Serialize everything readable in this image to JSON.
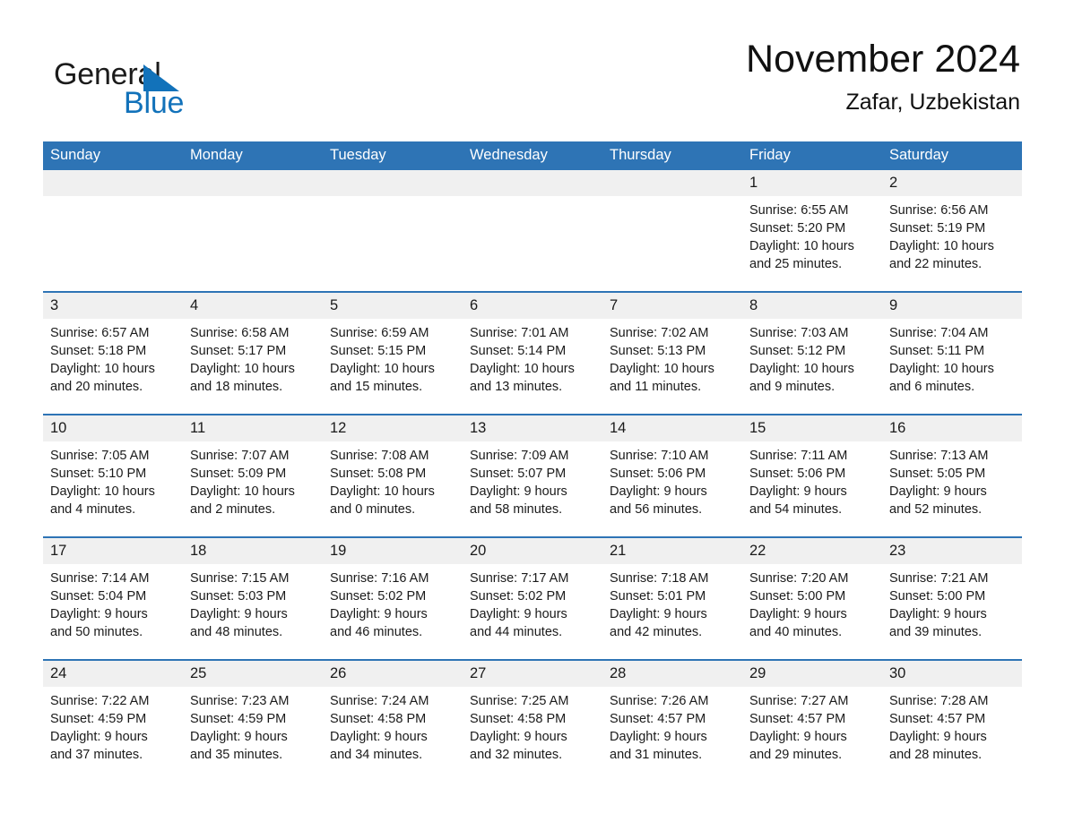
{
  "brand": {
    "name_part1": "General",
    "name_part2": "Blue",
    "logo_icon": "triangle-flag-icon",
    "accent_color": "#1272ba"
  },
  "header": {
    "title": "November 2024",
    "location": "Zafar, Uzbekistan"
  },
  "theme": {
    "header_blue": "#2e74b5",
    "daynum_band": "#f0f0f0",
    "text": "#1a1a1a"
  },
  "calendar": {
    "weekday_headers": [
      "Sunday",
      "Monday",
      "Tuesday",
      "Wednesday",
      "Thursday",
      "Friday",
      "Saturday"
    ],
    "labels": {
      "sunrise": "Sunrise:",
      "sunset": "Sunset:",
      "daylight": "Daylight:"
    },
    "weeks": [
      [
        {
          "day": "",
          "empty": true,
          "sunrise": "",
          "sunset": "",
          "daylight_line1": "",
          "daylight_line2": ""
        },
        {
          "day": "",
          "empty": true,
          "sunrise": "",
          "sunset": "",
          "daylight_line1": "",
          "daylight_line2": ""
        },
        {
          "day": "",
          "empty": true,
          "sunrise": "",
          "sunset": "",
          "daylight_line1": "",
          "daylight_line2": ""
        },
        {
          "day": "",
          "empty": true,
          "sunrise": "",
          "sunset": "",
          "daylight_line1": "",
          "daylight_line2": ""
        },
        {
          "day": "",
          "empty": true,
          "sunrise": "",
          "sunset": "",
          "daylight_line1": "",
          "daylight_line2": ""
        },
        {
          "day": "1",
          "empty": false,
          "sunrise": "Sunrise: 6:55 AM",
          "sunset": "Sunset: 5:20 PM",
          "daylight_line1": "Daylight: 10 hours",
          "daylight_line2": "and 25 minutes."
        },
        {
          "day": "2",
          "empty": false,
          "sunrise": "Sunrise: 6:56 AM",
          "sunset": "Sunset: 5:19 PM",
          "daylight_line1": "Daylight: 10 hours",
          "daylight_line2": "and 22 minutes."
        }
      ],
      [
        {
          "day": "3",
          "empty": false,
          "sunrise": "Sunrise: 6:57 AM",
          "sunset": "Sunset: 5:18 PM",
          "daylight_line1": "Daylight: 10 hours",
          "daylight_line2": "and 20 minutes."
        },
        {
          "day": "4",
          "empty": false,
          "sunrise": "Sunrise: 6:58 AM",
          "sunset": "Sunset: 5:17 PM",
          "daylight_line1": "Daylight: 10 hours",
          "daylight_line2": "and 18 minutes."
        },
        {
          "day": "5",
          "empty": false,
          "sunrise": "Sunrise: 6:59 AM",
          "sunset": "Sunset: 5:15 PM",
          "daylight_line1": "Daylight: 10 hours",
          "daylight_line2": "and 15 minutes."
        },
        {
          "day": "6",
          "empty": false,
          "sunrise": "Sunrise: 7:01 AM",
          "sunset": "Sunset: 5:14 PM",
          "daylight_line1": "Daylight: 10 hours",
          "daylight_line2": "and 13 minutes."
        },
        {
          "day": "7",
          "empty": false,
          "sunrise": "Sunrise: 7:02 AM",
          "sunset": "Sunset: 5:13 PM",
          "daylight_line1": "Daylight: 10 hours",
          "daylight_line2": "and 11 minutes."
        },
        {
          "day": "8",
          "empty": false,
          "sunrise": "Sunrise: 7:03 AM",
          "sunset": "Sunset: 5:12 PM",
          "daylight_line1": "Daylight: 10 hours",
          "daylight_line2": "and 9 minutes."
        },
        {
          "day": "9",
          "empty": false,
          "sunrise": "Sunrise: 7:04 AM",
          "sunset": "Sunset: 5:11 PM",
          "daylight_line1": "Daylight: 10 hours",
          "daylight_line2": "and 6 minutes."
        }
      ],
      [
        {
          "day": "10",
          "empty": false,
          "sunrise": "Sunrise: 7:05 AM",
          "sunset": "Sunset: 5:10 PM",
          "daylight_line1": "Daylight: 10 hours",
          "daylight_line2": "and 4 minutes."
        },
        {
          "day": "11",
          "empty": false,
          "sunrise": "Sunrise: 7:07 AM",
          "sunset": "Sunset: 5:09 PM",
          "daylight_line1": "Daylight: 10 hours",
          "daylight_line2": "and 2 minutes."
        },
        {
          "day": "12",
          "empty": false,
          "sunrise": "Sunrise: 7:08 AM",
          "sunset": "Sunset: 5:08 PM",
          "daylight_line1": "Daylight: 10 hours",
          "daylight_line2": "and 0 minutes."
        },
        {
          "day": "13",
          "empty": false,
          "sunrise": "Sunrise: 7:09 AM",
          "sunset": "Sunset: 5:07 PM",
          "daylight_line1": "Daylight: 9 hours",
          "daylight_line2": "and 58 minutes."
        },
        {
          "day": "14",
          "empty": false,
          "sunrise": "Sunrise: 7:10 AM",
          "sunset": "Sunset: 5:06 PM",
          "daylight_line1": "Daylight: 9 hours",
          "daylight_line2": "and 56 minutes."
        },
        {
          "day": "15",
          "empty": false,
          "sunrise": "Sunrise: 7:11 AM",
          "sunset": "Sunset: 5:06 PM",
          "daylight_line1": "Daylight: 9 hours",
          "daylight_line2": "and 54 minutes."
        },
        {
          "day": "16",
          "empty": false,
          "sunrise": "Sunrise: 7:13 AM",
          "sunset": "Sunset: 5:05 PM",
          "daylight_line1": "Daylight: 9 hours",
          "daylight_line2": "and 52 minutes."
        }
      ],
      [
        {
          "day": "17",
          "empty": false,
          "sunrise": "Sunrise: 7:14 AM",
          "sunset": "Sunset: 5:04 PM",
          "daylight_line1": "Daylight: 9 hours",
          "daylight_line2": "and 50 minutes."
        },
        {
          "day": "18",
          "empty": false,
          "sunrise": "Sunrise: 7:15 AM",
          "sunset": "Sunset: 5:03 PM",
          "daylight_line1": "Daylight: 9 hours",
          "daylight_line2": "and 48 minutes."
        },
        {
          "day": "19",
          "empty": false,
          "sunrise": "Sunrise: 7:16 AM",
          "sunset": "Sunset: 5:02 PM",
          "daylight_line1": "Daylight: 9 hours",
          "daylight_line2": "and 46 minutes."
        },
        {
          "day": "20",
          "empty": false,
          "sunrise": "Sunrise: 7:17 AM",
          "sunset": "Sunset: 5:02 PM",
          "daylight_line1": "Daylight: 9 hours",
          "daylight_line2": "and 44 minutes."
        },
        {
          "day": "21",
          "empty": false,
          "sunrise": "Sunrise: 7:18 AM",
          "sunset": "Sunset: 5:01 PM",
          "daylight_line1": "Daylight: 9 hours",
          "daylight_line2": "and 42 minutes."
        },
        {
          "day": "22",
          "empty": false,
          "sunrise": "Sunrise: 7:20 AM",
          "sunset": "Sunset: 5:00 PM",
          "daylight_line1": "Daylight: 9 hours",
          "daylight_line2": "and 40 minutes."
        },
        {
          "day": "23",
          "empty": false,
          "sunrise": "Sunrise: 7:21 AM",
          "sunset": "Sunset: 5:00 PM",
          "daylight_line1": "Daylight: 9 hours",
          "daylight_line2": "and 39 minutes."
        }
      ],
      [
        {
          "day": "24",
          "empty": false,
          "sunrise": "Sunrise: 7:22 AM",
          "sunset": "Sunset: 4:59 PM",
          "daylight_line1": "Daylight: 9 hours",
          "daylight_line2": "and 37 minutes."
        },
        {
          "day": "25",
          "empty": false,
          "sunrise": "Sunrise: 7:23 AM",
          "sunset": "Sunset: 4:59 PM",
          "daylight_line1": "Daylight: 9 hours",
          "daylight_line2": "and 35 minutes."
        },
        {
          "day": "26",
          "empty": false,
          "sunrise": "Sunrise: 7:24 AM",
          "sunset": "Sunset: 4:58 PM",
          "daylight_line1": "Daylight: 9 hours",
          "daylight_line2": "and 34 minutes."
        },
        {
          "day": "27",
          "empty": false,
          "sunrise": "Sunrise: 7:25 AM",
          "sunset": "Sunset: 4:58 PM",
          "daylight_line1": "Daylight: 9 hours",
          "daylight_line2": "and 32 minutes."
        },
        {
          "day": "28",
          "empty": false,
          "sunrise": "Sunrise: 7:26 AM",
          "sunset": "Sunset: 4:57 PM",
          "daylight_line1": "Daylight: 9 hours",
          "daylight_line2": "and 31 minutes."
        },
        {
          "day": "29",
          "empty": false,
          "sunrise": "Sunrise: 7:27 AM",
          "sunset": "Sunset: 4:57 PM",
          "daylight_line1": "Daylight: 9 hours",
          "daylight_line2": "and 29 minutes."
        },
        {
          "day": "30",
          "empty": false,
          "sunrise": "Sunrise: 7:28 AM",
          "sunset": "Sunset: 4:57 PM",
          "daylight_line1": "Daylight: 9 hours",
          "daylight_line2": "and 28 minutes."
        }
      ]
    ]
  }
}
